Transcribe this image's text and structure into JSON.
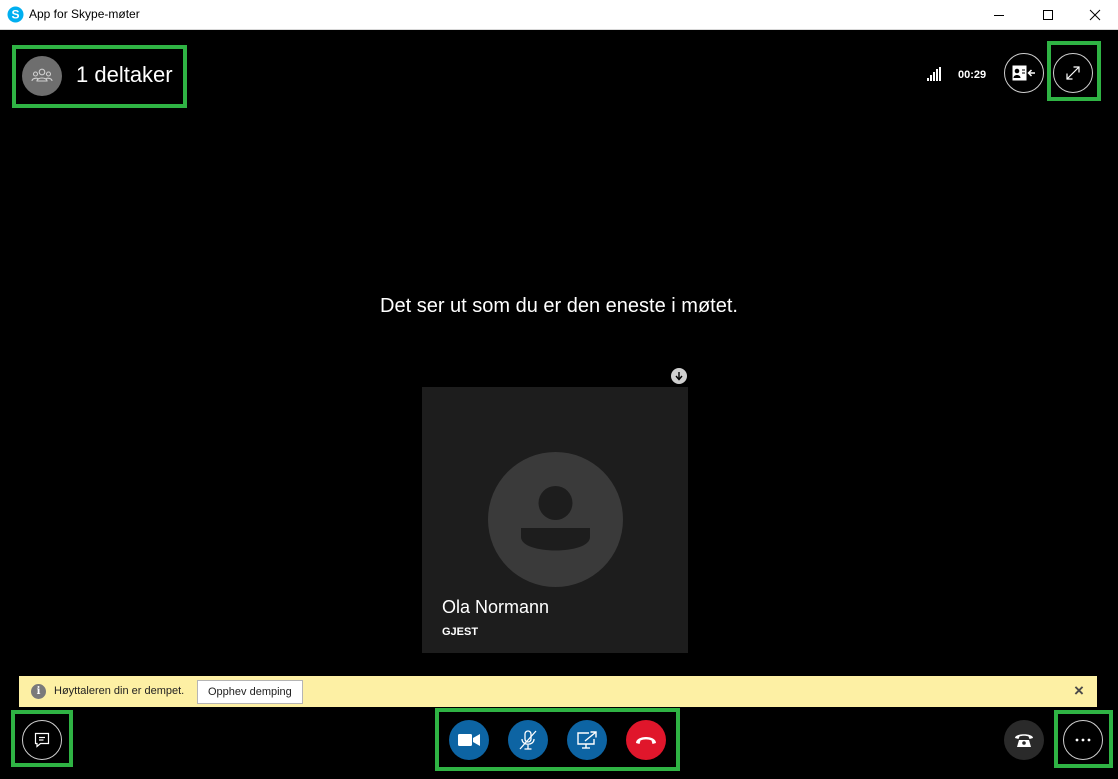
{
  "window": {
    "title": "App for Skype-møter"
  },
  "header": {
    "participants_label": "1 deltaker",
    "call_timer": "00:29"
  },
  "main": {
    "alone_message": "Det ser ut som du er den eneste i møtet."
  },
  "participant_tile": {
    "name": "Ola Normann",
    "role": "GJEST"
  },
  "notification": {
    "text": "Høyttaleren din er dempet.",
    "button_label": "Opphev demping"
  },
  "colors": {
    "highlight": "#2fb344",
    "control_blue": "#0d64a3",
    "end_call_red": "#e0162b",
    "notification_bg": "#fdf0a4",
    "skype_blue": "#00aff0"
  },
  "icons": {
    "app": "skype-logo-icon",
    "participants": "people-icon",
    "signal": "signal-strength-icon",
    "contact_card": "contact-card-icon",
    "fullscreen": "expand-icon",
    "download": "arrow-down-icon",
    "chat": "chat-icon",
    "video": "video-camera-icon",
    "mute": "microphone-muted-icon",
    "share": "share-screen-icon",
    "hangup": "hang-up-icon",
    "phone": "phone-icon",
    "more": "more-options-icon"
  }
}
